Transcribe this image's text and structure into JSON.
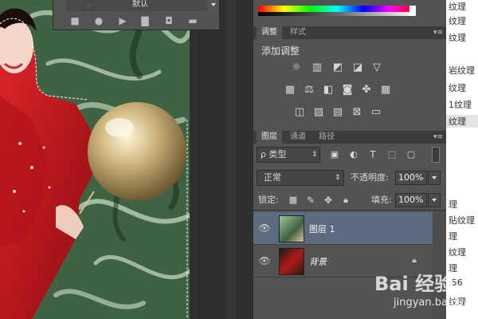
{
  "actions_panel": {
    "row_label": "默认",
    "buttons": [
      "stop-icon",
      "record-icon",
      "play-icon",
      "folder-icon",
      "new-action-icon",
      "trash-icon"
    ]
  },
  "adjustments_panel": {
    "tabs": [
      "调整",
      "样式"
    ],
    "title": "添加调整"
  },
  "layers_panel": {
    "tabs": [
      "图层",
      "通道",
      "路径"
    ],
    "filter_kind": "ρ 类型",
    "blend_mode": "正常",
    "opacity_label": "不透明度:",
    "opacity_value": "100%",
    "lock_label": "锁定:",
    "fill_label": "填充:",
    "fill_value": "100%",
    "layers": [
      {
        "name": "图层 1",
        "selected": true,
        "visible": true
      },
      {
        "name": "背景",
        "selected": false,
        "visible": true,
        "locked": true
      }
    ]
  },
  "background_list": {
    "items": [
      "纹理",
      "纹理",
      "纹理",
      "岩纹理",
      "纹理",
      "1纹理",
      "纹理",
      "理",
      "贴纹理",
      "理",
      "纹理",
      "理",
      "纹理",
      ":56"
    ],
    "selected_index": 6
  },
  "watermark": {
    "brand": "Bai 经验",
    "url": "jingyan.baidu.com"
  },
  "colors": {
    "panel_bg": "#535353",
    "panel_header": "#3c3c3c",
    "selected_layer": "#5d6b80",
    "canvas_green": "#4a6b4c",
    "dress_red": "#c0151a"
  }
}
